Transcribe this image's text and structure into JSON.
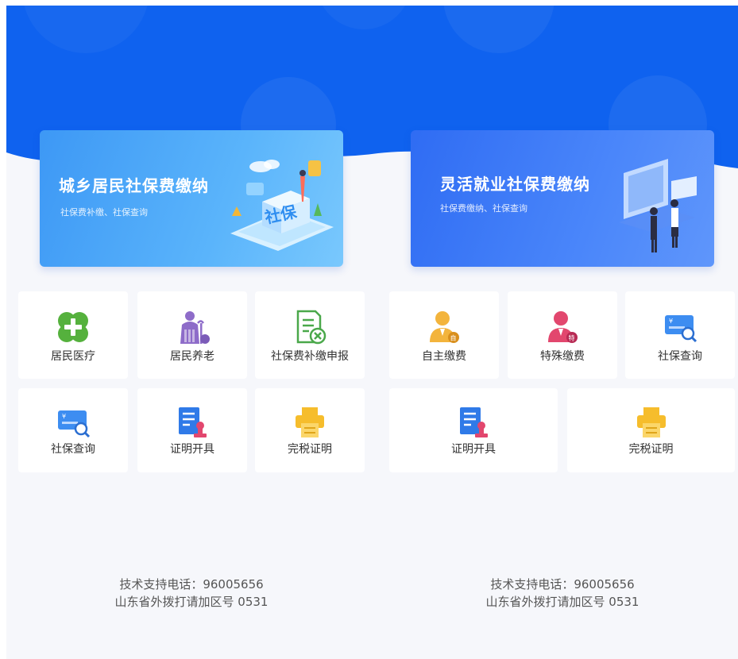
{
  "colors": {
    "hero_blue": "#0f62ef",
    "banner_left": "#4ba8f8",
    "banner_right": "#3f7cf7",
    "tile_bg": "#ffffff",
    "page_bg": "#f6f7fb",
    "medical_green": "#55b13d",
    "pension_purple": "#8e6cc9",
    "report_green": "#4aa84a",
    "self_pay_gold": "#f3b43c",
    "special_pay_red": "#e2476e",
    "query_blue": "#3d8df1",
    "cert_blue": "#2f7ae8",
    "print_gold": "#f6bd2c"
  },
  "left_panel": {
    "banner": {
      "title": "城乡居民社保费缴纳",
      "subtitle": "社保费补缴、社保查询",
      "art_text": "社保"
    },
    "tiles": [
      {
        "label": "居民医疗",
        "icon": "medical-cross-icon"
      },
      {
        "label": "居民养老",
        "icon": "elderly-person-icon"
      },
      {
        "label": "社保费补缴申报",
        "icon": "document-cancel-icon"
      },
      {
        "label": "社保查询",
        "icon": "card-search-icon"
      },
      {
        "label": "证明开具",
        "icon": "certificate-stamp-icon"
      },
      {
        "label": "完税证明",
        "icon": "printer-icon"
      }
    ],
    "support": {
      "phone_line": "技术支持电话：96005656",
      "note_line": "山东省外拨打请加区号 0531"
    }
  },
  "right_panel": {
    "banner": {
      "title": "灵活就业社保费缴纳",
      "subtitle": "社保费缴纳、社保查询"
    },
    "tiles": [
      {
        "label": "自主缴费",
        "icon": "person-self-icon",
        "badge": "自"
      },
      {
        "label": "特殊缴费",
        "icon": "person-special-icon",
        "badge": "特"
      },
      {
        "label": "社保查询",
        "icon": "card-search-icon"
      },
      {
        "label": "证明开具",
        "icon": "certificate-stamp-icon"
      },
      {
        "label": "完税证明",
        "icon": "printer-icon"
      }
    ],
    "support": {
      "phone_line": "技术支持电话：96005656",
      "note_line": "山东省外拨打请加区号 0531"
    }
  }
}
